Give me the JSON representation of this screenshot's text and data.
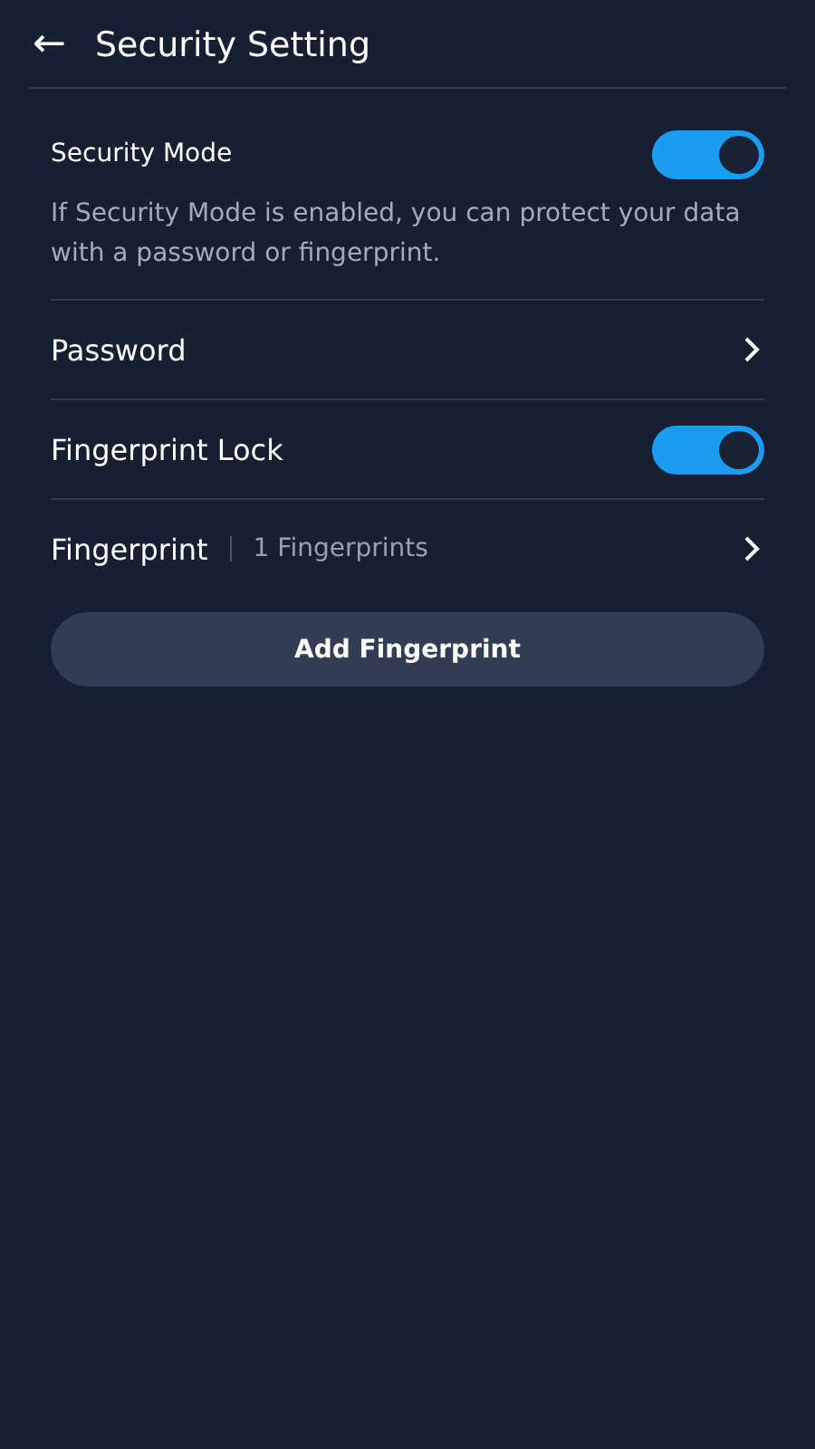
{
  "header": {
    "back_icon": "←",
    "title": "Security Setting"
  },
  "settings": [
    {
      "kind": "toggle",
      "label": "Security Mode",
      "on": true,
      "description": "If Security Mode is enabled, you can protect your data with a password or fingerprint."
    },
    {
      "kind": "link",
      "label": "Password"
    },
    {
      "kind": "toggle",
      "label": "Fingerprint Lock",
      "on": true
    },
    {
      "kind": "link",
      "label": "Fingerprint",
      "detail": "1 Fingerprints"
    }
  ],
  "button": {
    "label": "Add Fingerprint"
  }
}
